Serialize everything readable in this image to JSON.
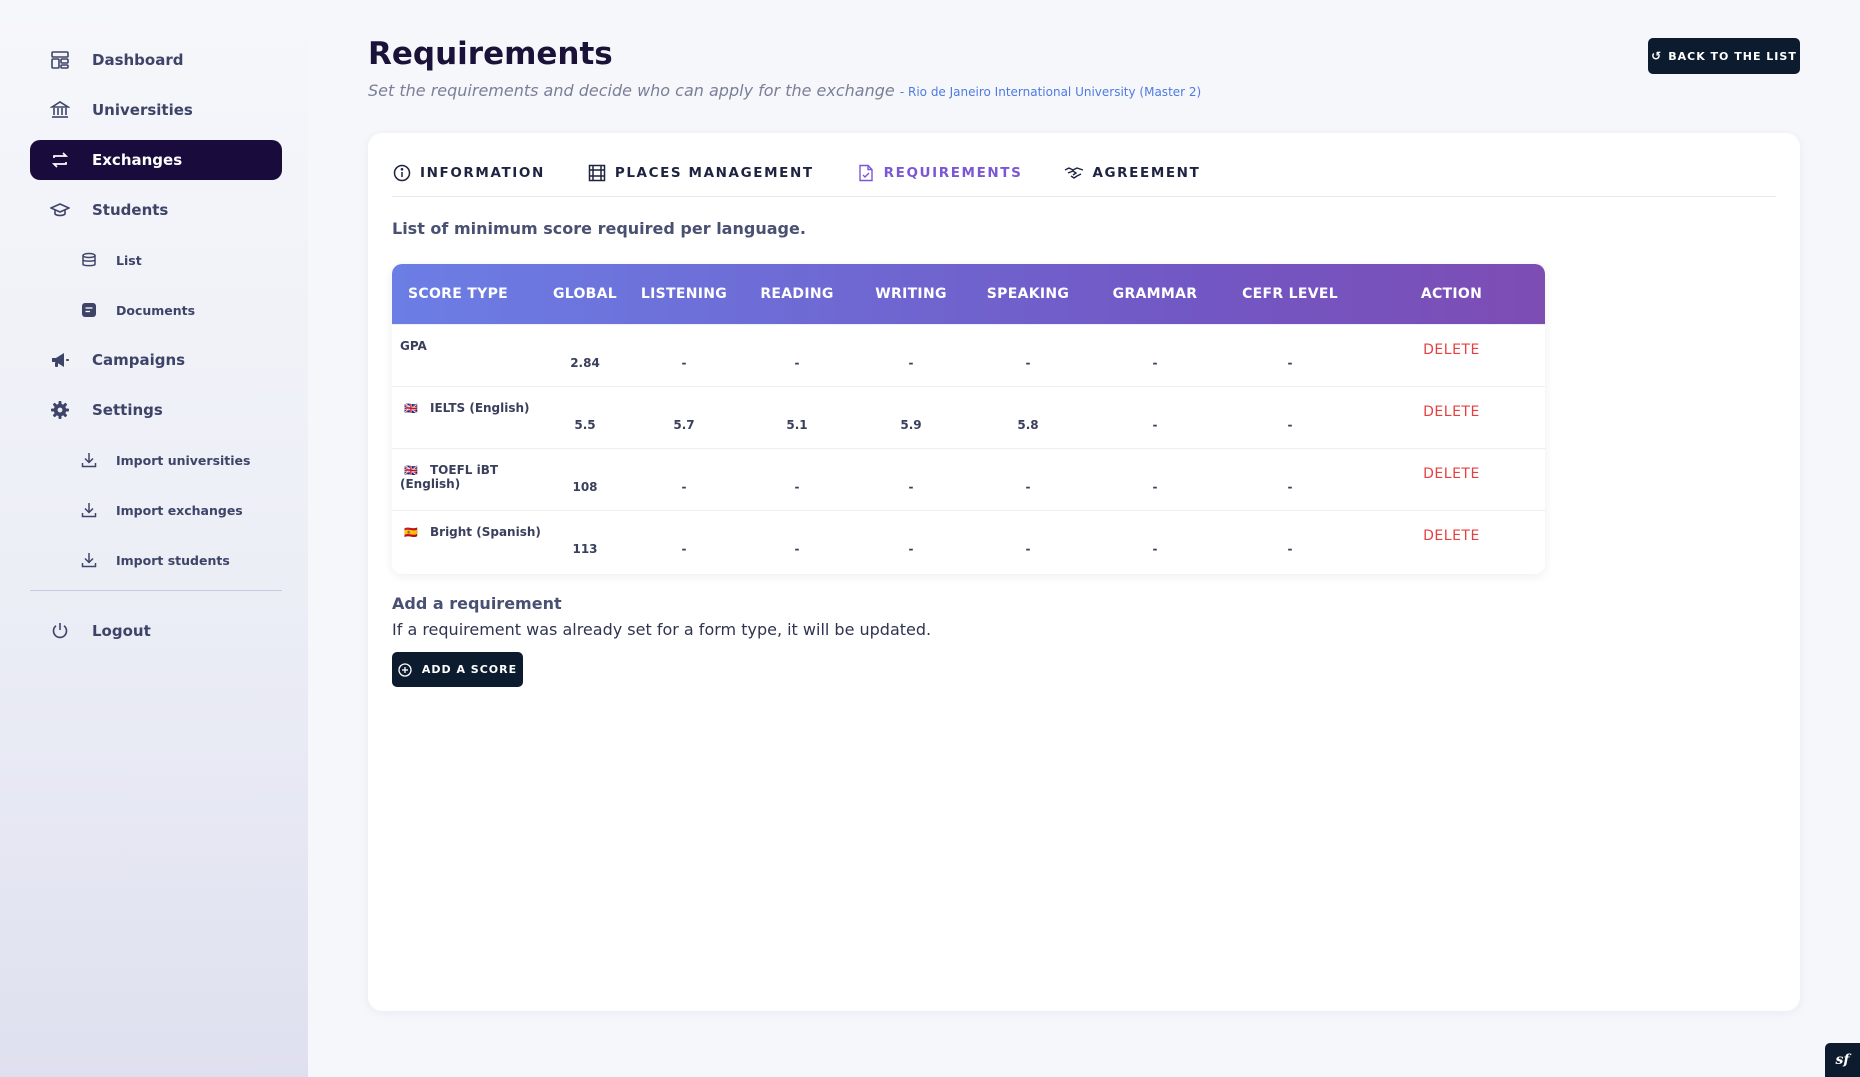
{
  "sidebar": {
    "items": [
      {
        "label": "Dashboard",
        "icon": "dashboard-icon"
      },
      {
        "label": "Universities",
        "icon": "bank-icon"
      },
      {
        "label": "Exchanges",
        "icon": "exchange-icon",
        "active": true
      },
      {
        "label": "Students",
        "icon": "graduation-cap-icon"
      }
    ],
    "students_sub": [
      {
        "label": "List",
        "icon": "database-icon"
      },
      {
        "label": "Documents",
        "icon": "document-icon"
      }
    ],
    "campaigns": {
      "label": "Campaigns",
      "icon": "megaphone-icon"
    },
    "settings": {
      "label": "Settings",
      "icon": "gear-icon"
    },
    "settings_sub": [
      {
        "label": "Import universities",
        "icon": "download-icon"
      },
      {
        "label": "Import exchanges",
        "icon": "download-icon"
      },
      {
        "label": "Import students",
        "icon": "download-icon"
      }
    ],
    "logout": {
      "label": "Logout",
      "icon": "power-icon"
    }
  },
  "header": {
    "title": "Requirements",
    "subtitle": "Set the requirements and decide who can apply for the exchange",
    "exchange_link": "- Rio de Janeiro International University (Master 2)",
    "back_button": "BACK TO THE LIST"
  },
  "tabs": [
    {
      "label": "INFORMATION",
      "icon": "info-icon"
    },
    {
      "label": "PLACES MANAGEMENT",
      "icon": "grid-icon"
    },
    {
      "label": "REQUIREMENTS",
      "icon": "file-check-icon",
      "active": true
    },
    {
      "label": "AGREEMENT",
      "icon": "handshake-icon"
    }
  ],
  "requirements": {
    "intro": "List of minimum score required per language.",
    "columns": [
      "SCORE TYPE",
      "GLOBAL",
      "LISTENING",
      "READING",
      "WRITING",
      "SPEAKING",
      "GRAMMAR",
      "CEFR LEVEL",
      "ACTION"
    ],
    "rows": [
      {
        "flag": "",
        "type": "GPA",
        "global": "2.84",
        "listening": "-",
        "reading": "-",
        "writing": "-",
        "speaking": "-",
        "grammar": "-",
        "cefr": "-",
        "action": "DELETE"
      },
      {
        "flag": "🇬🇧",
        "type": "IELTS (English)",
        "global": "5.5",
        "listening": "5.7",
        "reading": "5.1",
        "writing": "5.9",
        "speaking": "5.8",
        "grammar": "-",
        "cefr": "-",
        "action": "DELETE"
      },
      {
        "flag": "🇬🇧",
        "type": "TOEFL iBT (English)",
        "global": "108",
        "listening": "-",
        "reading": "-",
        "writing": "-",
        "speaking": "-",
        "grammar": "-",
        "cefr": "-",
        "action": "DELETE"
      },
      {
        "flag": "🇪🇸",
        "type": "Bright (Spanish)",
        "global": "113",
        "listening": "-",
        "reading": "-",
        "writing": "-",
        "speaking": "-",
        "grammar": "-",
        "cefr": "-",
        "action": "DELETE"
      }
    ]
  },
  "add_requirement": {
    "title": "Add a requirement",
    "description": "If a requirement was already set for a form type, it will be updated.",
    "button": "ADD A SCORE"
  },
  "corner_badge": "sf",
  "colors": {
    "active_nav": "#190b3c",
    "button_dark": "#0d1b2e",
    "tab_active": "#7b57d6",
    "delete": "#e54040",
    "link": "#4f7be0"
  }
}
